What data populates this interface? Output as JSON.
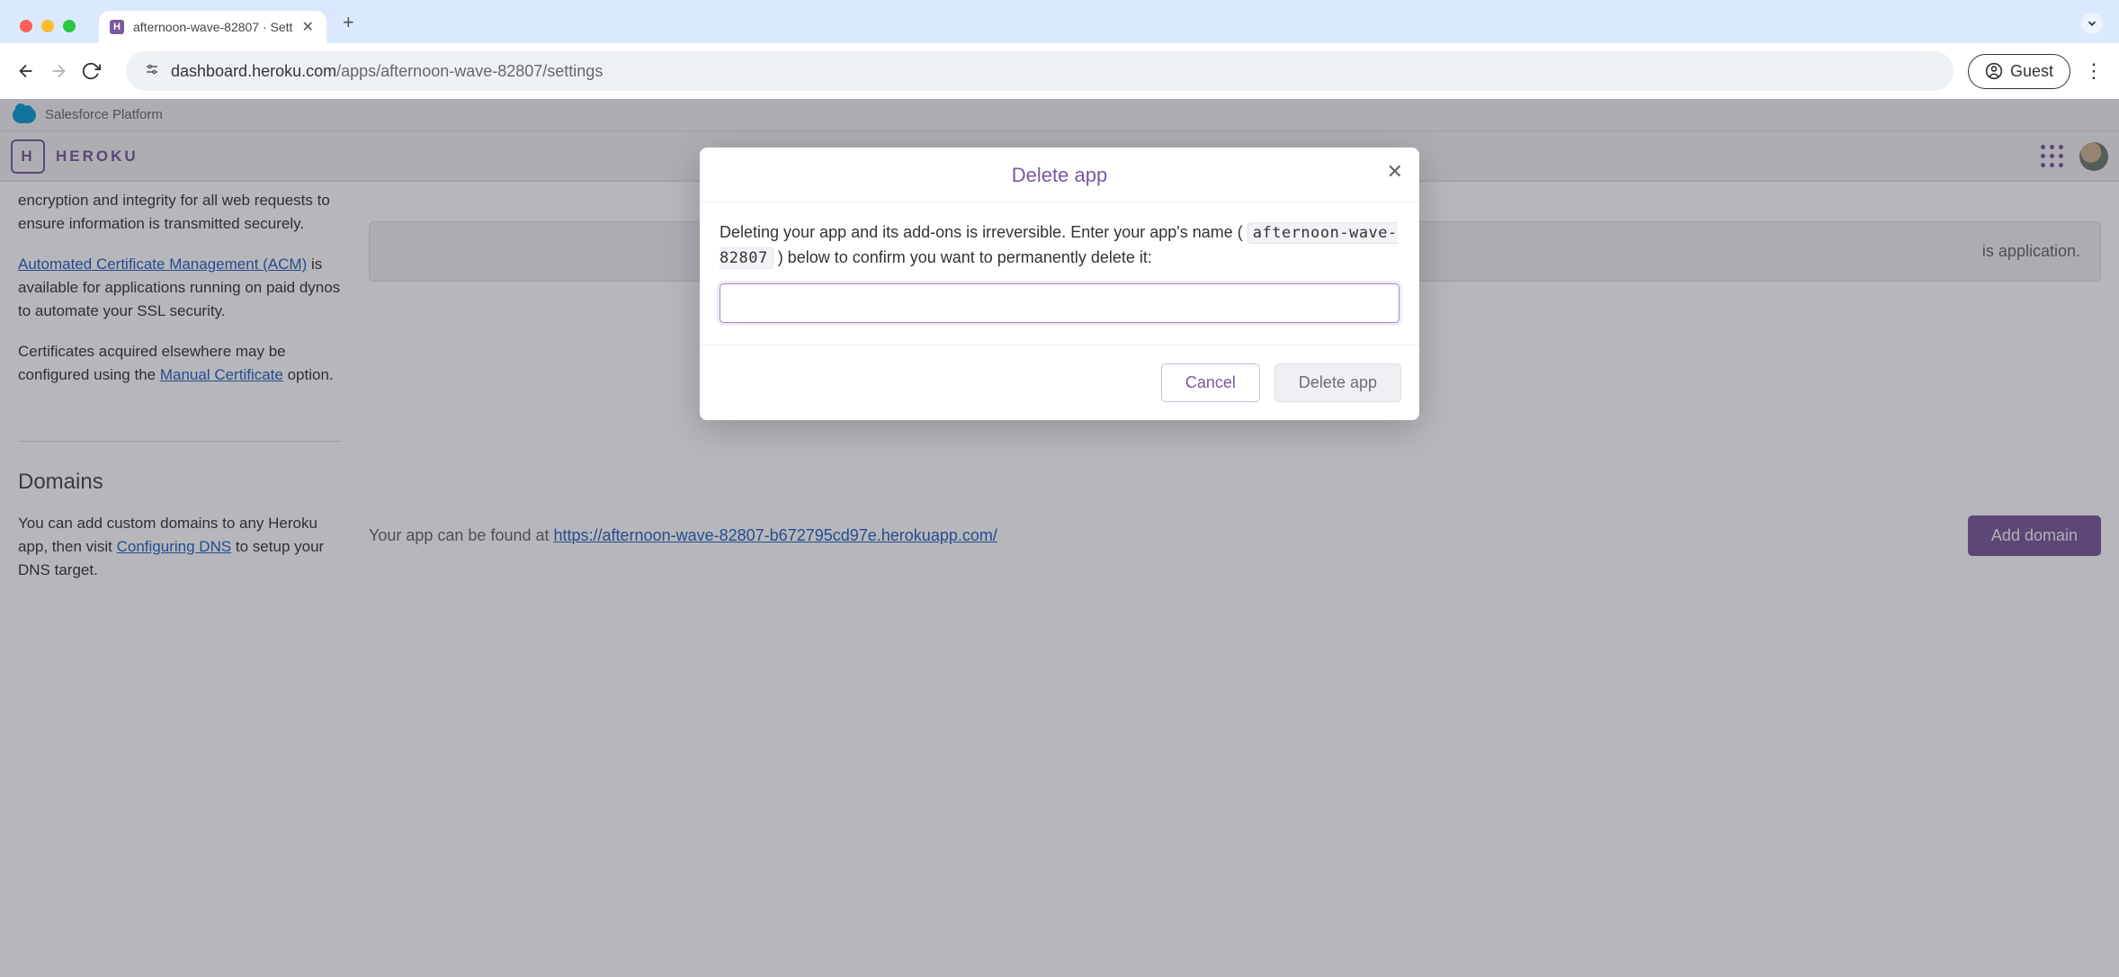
{
  "browser": {
    "tab_title": "afternoon-wave-82807 · Sett",
    "url_host": "dashboard.heroku.com",
    "url_path": "/apps/afternoon-wave-82807/settings",
    "guest_label": "Guest",
    "favicon_letter": "H"
  },
  "salesforce_bar": {
    "label": "Salesforce Platform"
  },
  "heroku_header": {
    "brand": "HEROKU",
    "logo_letter": "H"
  },
  "ssl_section": {
    "line1": "encryption and integrity for all web requests to ensure information is transmitted securely.",
    "acm_link": "Automated Certificate Management (ACM)",
    "acm_tail": " is available for applications running on paid dynos to automate your SSL security.",
    "manual_pre": "Certificates acquired elsewhere may be configured using the ",
    "manual_link": "Manual Certificate",
    "manual_tail": " option.",
    "empty_msg_tail": "is application."
  },
  "domains_section": {
    "heading": "Domains",
    "desc_pre": "You can add custom domains to any Heroku app, then visit ",
    "desc_link": "Configuring DNS",
    "desc_tail": " to setup your DNS target.",
    "found_pre": "Your app can be found at ",
    "found_url": "https://afternoon-wave-82807-b672795cd97e.herokuapp.com/",
    "add_button": "Add domain"
  },
  "modal": {
    "title": "Delete app",
    "body_pre": "Deleting your app and its add-ons is irreversible. Enter your app's name ( ",
    "app_name": "afternoon-wave-82807",
    "body_post": " ) below to confirm you want to permanently delete it:",
    "cancel": "Cancel",
    "confirm": "Delete app",
    "input_value": ""
  }
}
